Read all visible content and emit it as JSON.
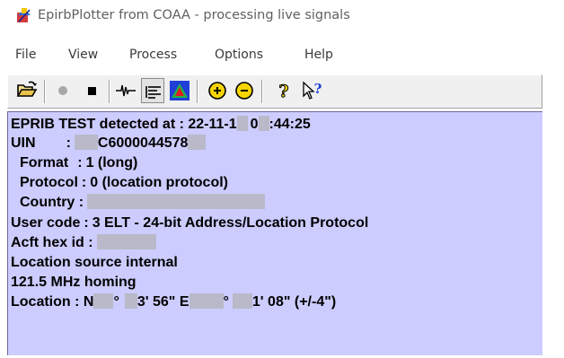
{
  "window": {
    "title": "EpirbPlotter from COAA - processing live signals",
    "app_icon": "epirb-plotter-app-icon"
  },
  "menu": {
    "items": [
      {
        "label": "File"
      },
      {
        "label": "View"
      },
      {
        "label": "Process"
      },
      {
        "label": "Options"
      },
      {
        "label": "Help"
      }
    ]
  },
  "toolbar": {
    "buttons": [
      {
        "icon": "open-folder-icon"
      },
      {
        "icon": "record-icon",
        "state": "disabled"
      },
      {
        "icon": "stop-icon"
      },
      {
        "icon": "waveform-icon"
      },
      {
        "icon": "text-align-icon",
        "state": "pressed"
      },
      {
        "icon": "map-plot-icon"
      },
      {
        "icon": "zoom-in-icon"
      },
      {
        "icon": "zoom-out-icon"
      },
      {
        "icon": "help-icon"
      },
      {
        "icon": "context-help-icon"
      }
    ]
  },
  "output": {
    "line1": {
      "label": "EPRIB TEST detected at : 22-11-1",
      "mid": "0",
      "suffix": ":44:25"
    },
    "line2": {
      "label": "UIN",
      "sep": ":",
      "value": "C6000044578"
    },
    "line3": {
      "label": "Format",
      "sep": ":",
      "value": "1 (long)"
    },
    "line4": {
      "label": "Protocol",
      "sep": ":",
      "value": "0 (location protocol)"
    },
    "line5": {
      "label": "Country :"
    },
    "line6": {
      "label": "User code",
      "sep": ":",
      "value": "3 ELT - 24-bit Address/Location Protocol"
    },
    "line7": {
      "label": "Acft hex id :"
    },
    "line8": {
      "text": "Location source internal"
    },
    "line9": {
      "text": "121.5 MHz homing"
    },
    "line10": {
      "prefix": "Location : N",
      "deg1": "°",
      "min1": "3' 56\" E",
      "deg2": "°",
      "tail": "1' 08\" (+/-4\")"
    }
  },
  "colors": {
    "panel_bg": "#ccccff",
    "redaction": "#b9b9c9",
    "toolbar_bg": "#f0f0f0"
  }
}
